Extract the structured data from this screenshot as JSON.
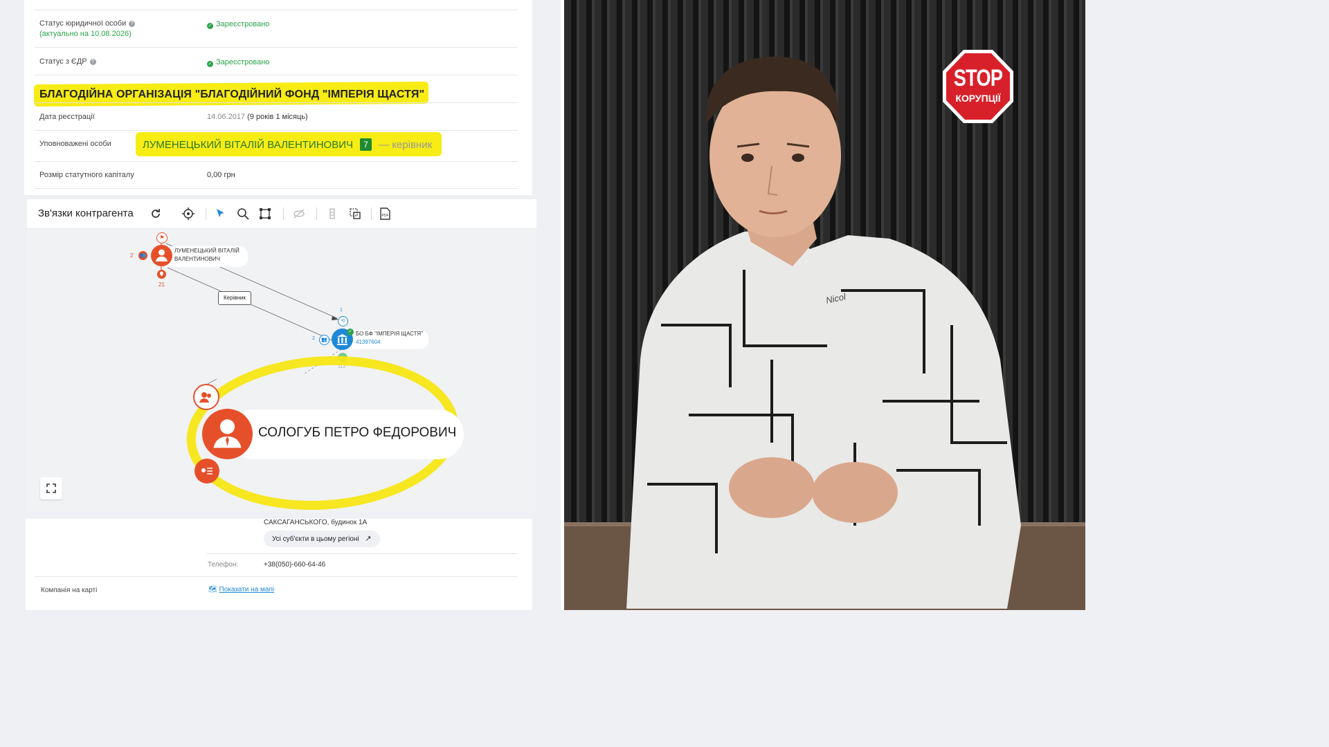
{
  "entity_status": {
    "label": "Статус юридичної особи",
    "sublabel": "(актуально на 10.08.2026)",
    "value": "Зареєстровано"
  },
  "edr_status": {
    "label": "Статус з ЄДР",
    "value": "Зареєстровано"
  },
  "org_title": "БЛАГОДІЙНА ОРГАНІЗАЦІЯ \"БЛАГОДІЙНИЙ ФОНД \"ІМПЕРІЯ ЩАСТЯ\"",
  "reg_date": {
    "label": "Дата реєстрації",
    "date": "14.06.2017",
    "duration": "(9 років 1 місяць)"
  },
  "authorized": {
    "label": "Уповноважені особи",
    "name": "ЛУМЕНЕЦЬКИЙ ВІТАЛІЙ ВАЛЕНТИНОВИЧ",
    "badge": "7",
    "role": "— керівник"
  },
  "capital": {
    "label": "Розмір статутного капіталу",
    "value": "0,00 грн"
  },
  "graph": {
    "title": "Зв'язки контрагента",
    "toolbar_icons": [
      "refresh-icon",
      "locate-icon",
      "cursor-icon",
      "search-icon",
      "select-area-icon",
      "hide-icon",
      "layout-icon",
      "crop-icon",
      "pdf-icon"
    ],
    "person1": {
      "name_line1": "ЛУМЕНЕЦЬКИЙ ВІТАЛІЙ",
      "name_line2": "ВАЛЕНТИНОВИЧ",
      "left_count": "2",
      "bottom_count": "21"
    },
    "edge_label": "Керівник",
    "org_node": {
      "name": "БО БФ \"ІМПЕРІЯ ЩАСТЯ\"",
      "code": "41397604",
      "top_count": "1",
      "left_count": "2",
      "bottom_count": "112"
    },
    "person2": {
      "name": "СОЛОГУБ ПЕТРО ФЕДОРОВИЧ"
    },
    "highlight_color": "#f5e614",
    "node_color": "#e5502a",
    "org_color": "#1e88d8"
  },
  "address": {
    "tail": "САКСАГАНСЬКОГО, будинок 1А",
    "region_button": "Усі суб'єкти в цьому регіоні"
  },
  "phone": {
    "label": "Телефон:",
    "value": "+38(050)-660-64-46"
  },
  "map": {
    "label": "Компанія на карті",
    "link": "Показати на мапі"
  },
  "stop_sign": {
    "line1": "STOP",
    "line2": "КОРУПЦІЇ"
  },
  "tattoo_text": "Nicol"
}
